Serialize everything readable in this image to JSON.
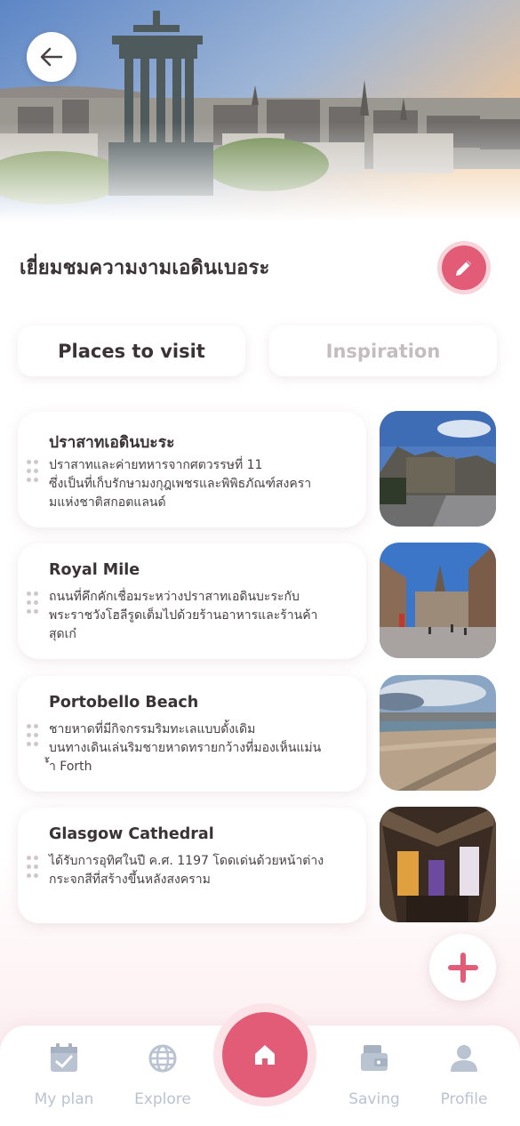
{
  "header": {
    "title": "เยี่ยมชมความงามเอดินเบอระ",
    "back_icon": "arrow-left-icon",
    "edit_icon": "pencil-icon"
  },
  "tabs": [
    {
      "label": "Places to visit",
      "active": true
    },
    {
      "label": "Inspiration",
      "active": false
    }
  ],
  "places": [
    {
      "name": "ปราสาทเอดินบะระ",
      "desc_lines": [
        "ปราสาทและค่ายทหารจากศตวรรษที่ 11",
        "ซึ่งเป็นที่เก็บรักษามงกุฎเพชรและพิพิธภัณฑ์สงครา",
        "มแห่งชาติสกอตแลนด์"
      ]
    },
    {
      "name": "Royal Mile",
      "desc_lines": [
        "ถนนที่คึกคักเชื่อมระหว่างปราสาทเอดินบะระกับ",
        "พระราชวังโฮลีรูดเต็มไปด้วยร้านอาหารและร้านค้า",
        "สุดเก๋"
      ]
    },
    {
      "name": "Portobello Beach",
      "desc_lines": [
        "ชายหาดที่มีกิจกรรมริมทะเลแบบดั้งเดิม",
        "บนทางเดินเล่นริมชายหาดทรายกว้างที่มองเห็นแม่น",
        "้ำ Forth"
      ]
    },
    {
      "name": "Glasgow Cathedral",
      "desc_lines": [
        "ได้รับการอุทิศในปี ค.ศ. 1197 โดดเด่นด้วยหน้าต่าง",
        "กระจกสีที่สร้างขึ้นหลังสงคราม"
      ]
    }
  ],
  "add_icon": "plus-icon",
  "nav": {
    "my_plan": "My plan",
    "explore": "Explore",
    "home_icon": "home-icon",
    "saving": "Saving",
    "profile": "Profile"
  },
  "colors": {
    "accent": "#e25c78",
    "accent_light": "#f7d3da",
    "text_dark": "#3b3236",
    "nav_inactive": "#b9c3d1"
  }
}
